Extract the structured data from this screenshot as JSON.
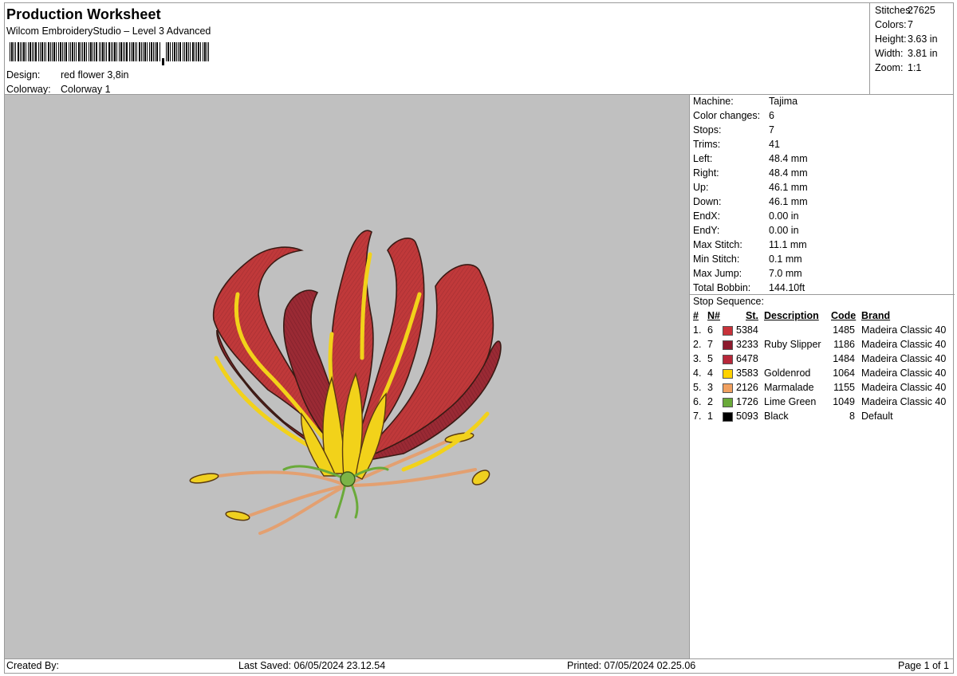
{
  "header": {
    "title": "Production Worksheet",
    "software": "Wilcom EmbroideryStudio – Level 3 Advanced",
    "design_label": "Design:",
    "design_value": "red flower 3,8in",
    "colorway_label": "Colorway:",
    "colorway_value": "Colorway 1"
  },
  "summary": {
    "stitches_label": "Stitches:",
    "stitches": "27625",
    "colors_label": "Colors:",
    "colors": "7",
    "height_label": "Height:",
    "height": "3.63 in",
    "width_label": "Width:",
    "width": "3.81 in",
    "zoom_label": "Zoom:",
    "zoom": "1:1"
  },
  "machine_info": [
    {
      "label": "Machine:",
      "value": "Tajima"
    },
    {
      "label": "Color changes:",
      "value": "6"
    },
    {
      "label": "Stops:",
      "value": "7"
    },
    {
      "label": "Trims:",
      "value": "41"
    },
    {
      "label": "Left:",
      "value": "48.4 mm"
    },
    {
      "label": "Right:",
      "value": "48.4 mm"
    },
    {
      "label": "Up:",
      "value": "46.1 mm"
    },
    {
      "label": "Down:",
      "value": "46.1 mm"
    },
    {
      "label": "EndX:",
      "value": "0.00 in"
    },
    {
      "label": "EndY:",
      "value": "0.00 in"
    },
    {
      "label": "Max Stitch:",
      "value": "11.1 mm"
    },
    {
      "label": "Min Stitch:",
      "value": "0.1 mm"
    },
    {
      "label": "Max Jump:",
      "value": "7.0 mm"
    },
    {
      "label": "Total Bobbin:",
      "value": "144.10ft"
    }
  ],
  "stop_sequence": {
    "title": "Stop Sequence:",
    "headers": {
      "num": "#",
      "n": "N#",
      "st": "St.",
      "description": "Description",
      "code": "Code",
      "brand": "Brand"
    },
    "rows": [
      {
        "num": "1.",
        "n": "6",
        "color": "#c8323a",
        "st": "5384",
        "description": "",
        "code": "1485",
        "brand": "Madeira Classic 40"
      },
      {
        "num": "2.",
        "n": "7",
        "color": "#8c1a2c",
        "st": "3233",
        "description": "Ruby Slipper",
        "code": "1186",
        "brand": "Madeira Classic 40"
      },
      {
        "num": "3.",
        "n": "5",
        "color": "#b8283a",
        "st": "6478",
        "description": "",
        "code": "1484",
        "brand": "Madeira Classic 40"
      },
      {
        "num": "4.",
        "n": "4",
        "color": "#ffd200",
        "st": "3583",
        "description": "Goldenrod",
        "code": "1064",
        "brand": "Madeira Classic 40"
      },
      {
        "num": "5.",
        "n": "3",
        "color": "#f0a060",
        "st": "2126",
        "description": "Marmalade",
        "code": "1155",
        "brand": "Madeira Classic 40"
      },
      {
        "num": "6.",
        "n": "2",
        "color": "#6aaa3a",
        "st": "1726",
        "description": "Lime Green",
        "code": "1049",
        "brand": "Madeira Classic 40"
      },
      {
        "num": "7.",
        "n": "1",
        "color": "#000000",
        "st": "5093",
        "description": "Black",
        "code": "8",
        "brand": "Default"
      }
    ]
  },
  "footer": {
    "created_by": "Created By:",
    "last_saved": "Last Saved: 06/05/2024 23.12.54",
    "printed": "Printed: 07/05/2024 02.25.06",
    "page": "Page 1 of 1"
  },
  "canvas": {
    "background": "#c0c0c0",
    "colors": {
      "red_main": "#c0393a",
      "red_dark": "#8e2430",
      "yellow": "#f2d21a",
      "orange": "#e8a870",
      "green": "#7cb347",
      "outline": "#3a1a14"
    }
  }
}
